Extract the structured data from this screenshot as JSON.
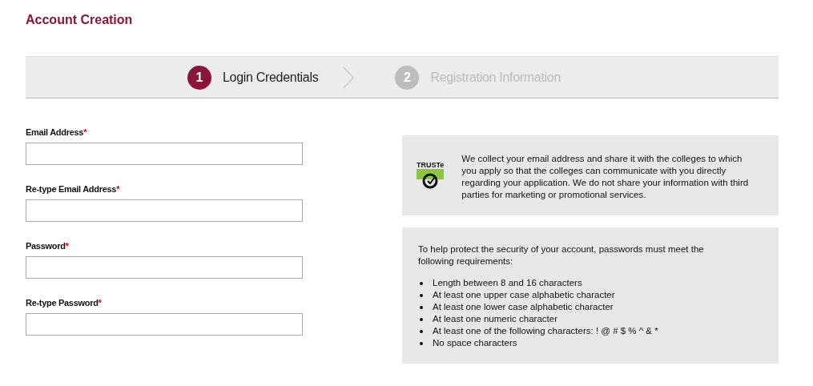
{
  "title": "Account Creation",
  "steps": [
    {
      "number": "1",
      "label": "Login Credentials",
      "selected": true
    },
    {
      "number": "2",
      "label": "Registration Information",
      "selected": false
    }
  ],
  "required_mark": "*",
  "fields": [
    {
      "label": "Email Address",
      "required": true
    },
    {
      "label": "Re-type Email Address",
      "required": true
    },
    {
      "label": "Password",
      "required": true
    },
    {
      "label": "Re-type Password",
      "required": true
    }
  ],
  "privacy": {
    "badge": "TRUSTe",
    "text": "We collect your email address and share it with the colleges to which you apply so that the colleges can communicate with you directly regarding your application. We do not share your information with third parties for marketing or promotional services."
  },
  "requirements": {
    "intro": "To help protect the security of your account, passwords must meet the following requirements:",
    "items": [
      "Length between 8 and 16 characters",
      "At least one upper case alphabetic character",
      "At least one lower case alphabetic character",
      "At least one numeric character",
      "At least one of the following characters: ! @ # $ % ^ & *",
      "No space characters"
    ]
  }
}
